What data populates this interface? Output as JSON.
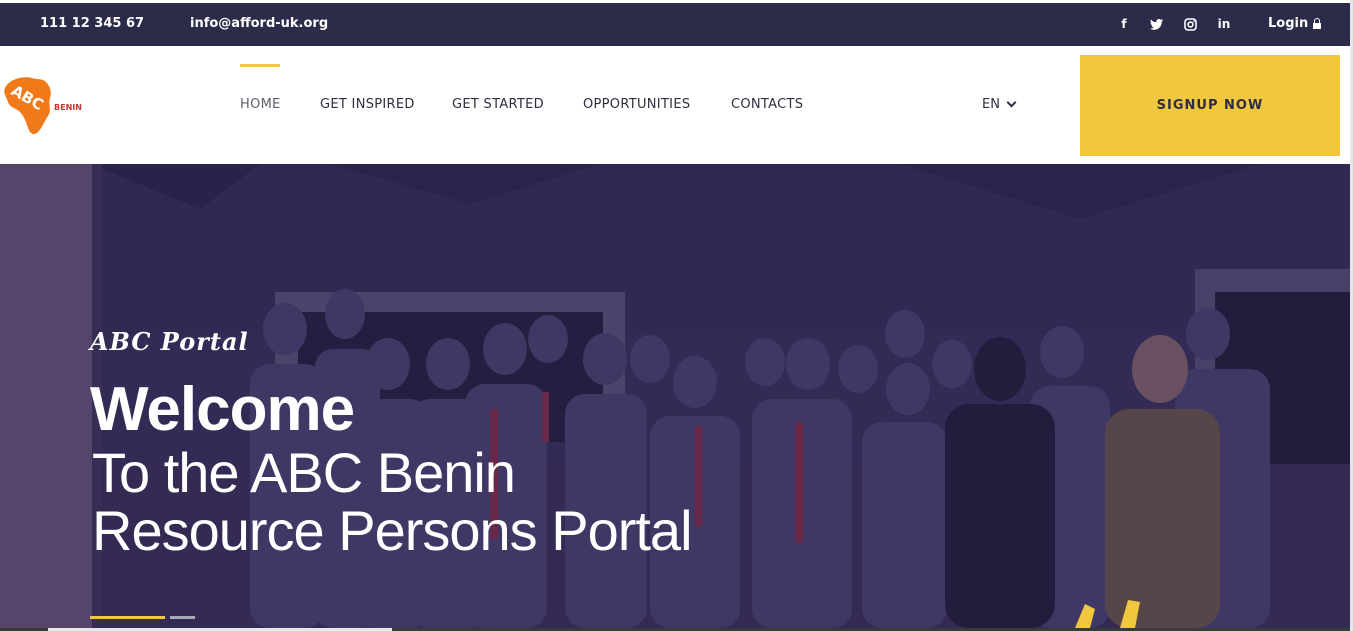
{
  "topbar": {
    "phone": "111 12 345 67",
    "email": "info@afford-uk.org",
    "social_icons": [
      "facebook-icon",
      "twitter-icon",
      "instagram-icon",
      "linkedin-icon"
    ],
    "social_glyphs": [
      "f",
      "t",
      "◎",
      "in"
    ],
    "login_label": "Login",
    "login_icon": "lock-icon"
  },
  "header": {
    "logo_text": "ABC",
    "logo_sub": "BENIN",
    "nav": [
      {
        "label": "HOME",
        "active": true
      },
      {
        "label": "GET INSPIRED",
        "active": false
      },
      {
        "label": "GET STARTED",
        "active": false
      },
      {
        "label": "OPPORTUNITIES",
        "active": false
      },
      {
        "label": "CONTACTS",
        "active": false
      }
    ],
    "language": "EN",
    "signup_label": "SIGNUP NOW"
  },
  "hero": {
    "tagline": "ABC Portal",
    "title": "Welcome",
    "subtitle_line1": "To the ABC Benin",
    "subtitle_line2": "Resource Persons Portal",
    "slides": 2,
    "active_slide": 1
  },
  "colors": {
    "topbar_bg": "#2c2c4a",
    "accent": "#f0c73e",
    "hero_overlay": "#2f2a52",
    "logo_orange": "#f07a1a"
  }
}
